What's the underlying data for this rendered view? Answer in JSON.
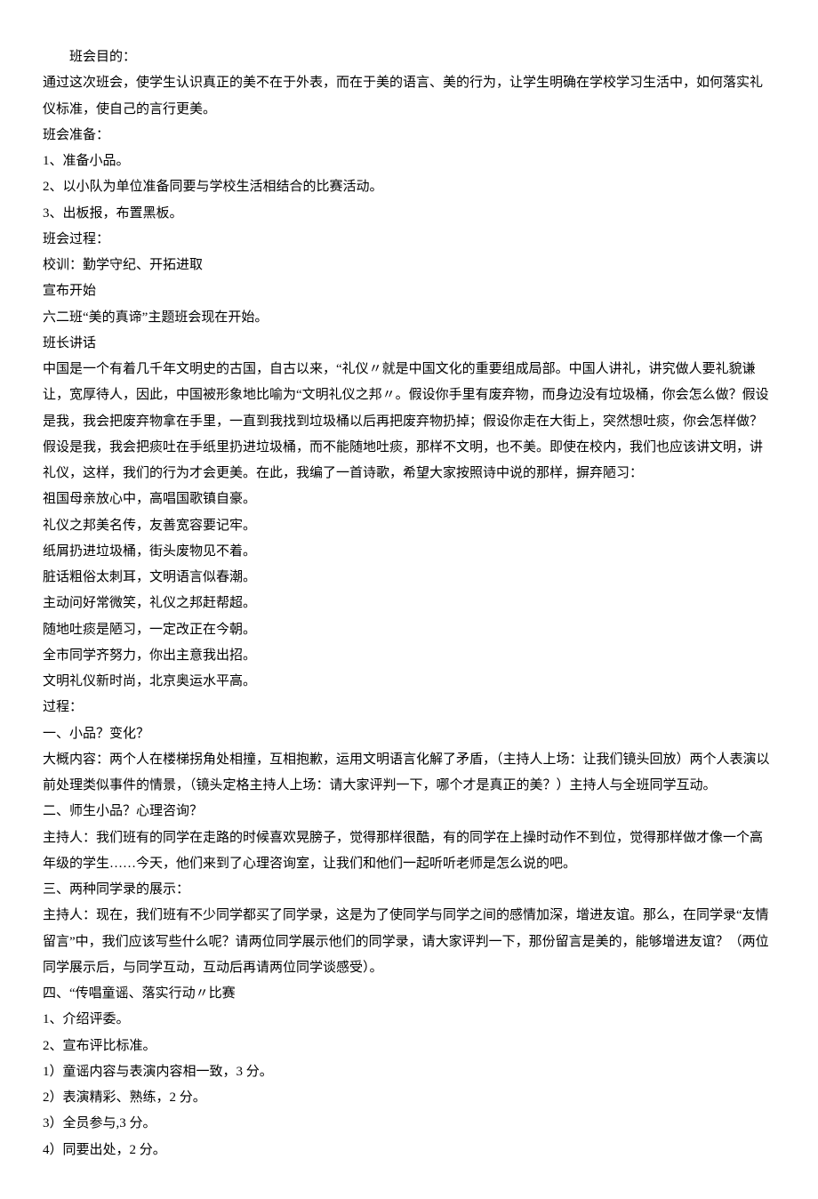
{
  "lines": {
    "l1": "班会目的：",
    "l2": "通过这次班会，使学生认识真正的美不在于外表，而在于美的语言、美的行为，让学生明确在学校学习生活中，如何落实礼仪标准，使自己的言行更美。",
    "l3": "班会准备：",
    "l4": "1、准备小品。",
    "l5": "2、以小队为单位准备同要与学校生活相结合的比赛活动。",
    "l6": "3、出板报，布置黑板。",
    "l7": "班会过程：",
    "l8": "校训：勤学守纪、开拓进取",
    "l9": "宣布开始",
    "l10": "六二班“美的真谛”主题班会现在开始。",
    "l11": "班长讲话",
    "l12": "中国是一个有着几千年文明史的古国，自古以来，“礼仪〃就是中国文化的重要组成局部。中国人讲礼，讲究做人要礼貌谦让，宽厚待人，因此，中国被形象地比喻为“文明礼仪之邦〃。假设你手里有废弃物，而身边没有垃圾桶，你会怎么做？假设是我，我会把废弃物拿在手里，一直到我找到垃圾桶以后再把废弃物扔掉；假设你走在大街上，突然想吐痰，你会怎样做？假设是我，我会把痰吐在手纸里扔进垃圾桶，而不能随地吐痰，那样不文明，也不美。即使在校内，我们也应该讲文明，讲礼仪，这样，我们的行为才会更美。在此，我编了一首诗歌，希望大家按照诗中说的那样，摒弃陋习：",
    "l13": "祖国母亲放心中，高唱国歌镇自豪。",
    "l14": "礼仪之邦美名传，友善宽容要记牢。",
    "l15": "纸屑扔进垃圾桶，街头废物见不着。",
    "l16": "脏话粗俗太刺耳，文明语言似春潮。",
    "l17": "主动问好常微笑，礼仪之邦赶帮超。",
    "l18": "随地吐痰是陋习，一定改正在今朝。",
    "l19": "全市同学齐努力，你出主意我出招。",
    "l20": "文明礼仪新时尚，北京奥运水平高。",
    "l21": "过程：",
    "l22": "一、小品？变化？",
    "l23": "大概内容：两个人在楼梯拐角处相撞，互相抱歉，运用文明语言化解了矛盾，（主持人上场：让我们镜头回放）两个人表演以前处理类似事件的情景，（镜头定格主持人上场：请大家评判一下，哪个才是真正的美？）主持人与全班同学互动。",
    "l24": "二、师生小品？心理咨询？",
    "l25": "主持人：我们班有的同学在走路的时候喜欢晃膀子，觉得那样很酷，有的同学在上操时动作不到位，觉得那样做才像一个高年级的学生……今天，他们来到了心理咨询室，让我们和他们一起听听老师是怎么说的吧。",
    "l26": "三、两种同学录的展示：",
    "l27": "主持人：现在，我们班有不少同学都买了同学录，这是为了使同学与同学之间的感情加深，增进友谊。那么，在同学录“友情留言”中，我们应该写些什么呢？请两位同学展示他们的同学录，请大家评判一下，那份留言是美的，能够增进友谊？（两位同学展示后，与同学互动，互动后再请两位同学谈感受）。",
    "l28": "四、“传唱童谣、落实行动〃比赛",
    "l29": "1、介绍评委。",
    "l30": "2、宣布评比标准。",
    "l31": "1）童谣内容与表演内容相一致，3 分。",
    "l32": "2）表演精彩、熟练，2 分。",
    "l33": "3）全员参与,3 分。",
    "l34": "4）同要出处，2 分。"
  }
}
